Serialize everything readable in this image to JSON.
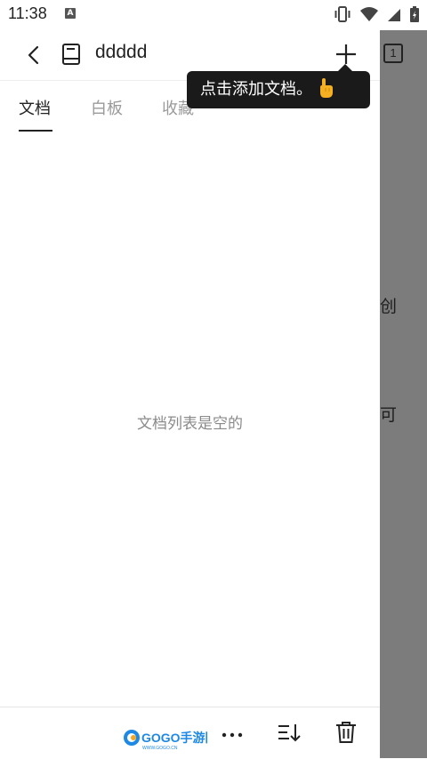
{
  "status_bar": {
    "time": "11:38",
    "notification_icon": "A"
  },
  "header": {
    "title": "ddddd",
    "back_icon": "chevron-left-icon",
    "book_icon": "book-icon",
    "add_icon": "plus-icon",
    "count": "1"
  },
  "tabs": [
    {
      "label": "文档",
      "active": true
    },
    {
      "label": "白板",
      "active": false
    },
    {
      "label": "收藏",
      "active": false
    }
  ],
  "main": {
    "empty_message": "文档列表是空的"
  },
  "tooltip": {
    "text": "点击添加文档。",
    "icon": "pointing-hand-icon"
  },
  "side_pane": {
    "line1": "创",
    "line2": "可"
  },
  "bottom_bar": {
    "watermark": "GOGO手游网",
    "watermark_sub": "WWW.GOGO.CN",
    "more_icon": "more-dots-icon",
    "sort_icon": "sort-icon",
    "delete_icon": "trash-icon"
  },
  "colors": {
    "accent": "#222222",
    "overlay": "#7c7c7c",
    "tooltip_bg": "#1a1a1a",
    "watermark_blue": "#1e88e5"
  }
}
